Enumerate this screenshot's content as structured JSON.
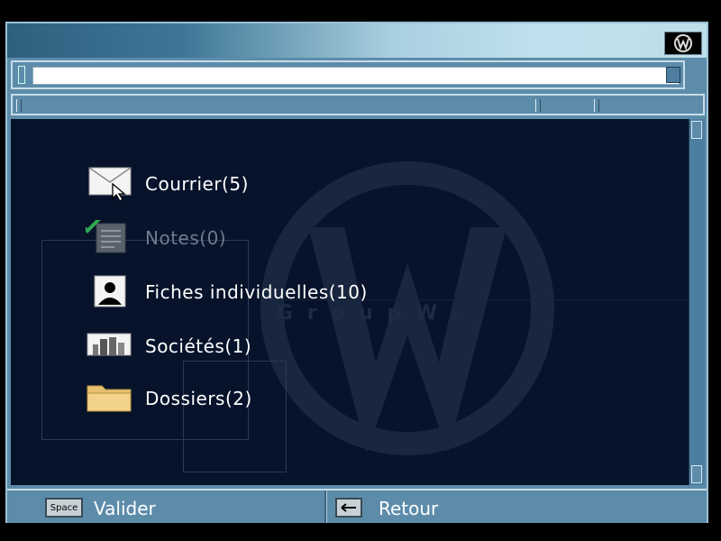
{
  "window": {
    "logo_icon": "group-w-logo-icon"
  },
  "search": {
    "value": "",
    "placeholder": ""
  },
  "menu": {
    "items": [
      {
        "label": "Courrier(5)",
        "icon": "envelope-icon",
        "enabled": true
      },
      {
        "label": "Notes(0)",
        "icon": "notes-icon",
        "enabled": false
      },
      {
        "label": "Fiches individuelles(10)",
        "icon": "person-card-icon",
        "enabled": true
      },
      {
        "label": "Sociétés(1)",
        "icon": "buildings-icon",
        "enabled": true
      },
      {
        "label": "Dossiers(2)",
        "icon": "folder-icon",
        "enabled": true
      }
    ]
  },
  "watermark": {
    "text": "G r o u p   W ."
  },
  "footer": {
    "validate_key": "Space",
    "validate_label": "Valider",
    "back_key_icon": "left-arrow-icon",
    "back_label": "Retour"
  },
  "colors": {
    "background": "#06132b",
    "frame": "#5d8cab",
    "text": "#ffffff",
    "disabled_text": "#6b7d8f",
    "check": "#2fa84f",
    "folder": "#f3d38a"
  }
}
